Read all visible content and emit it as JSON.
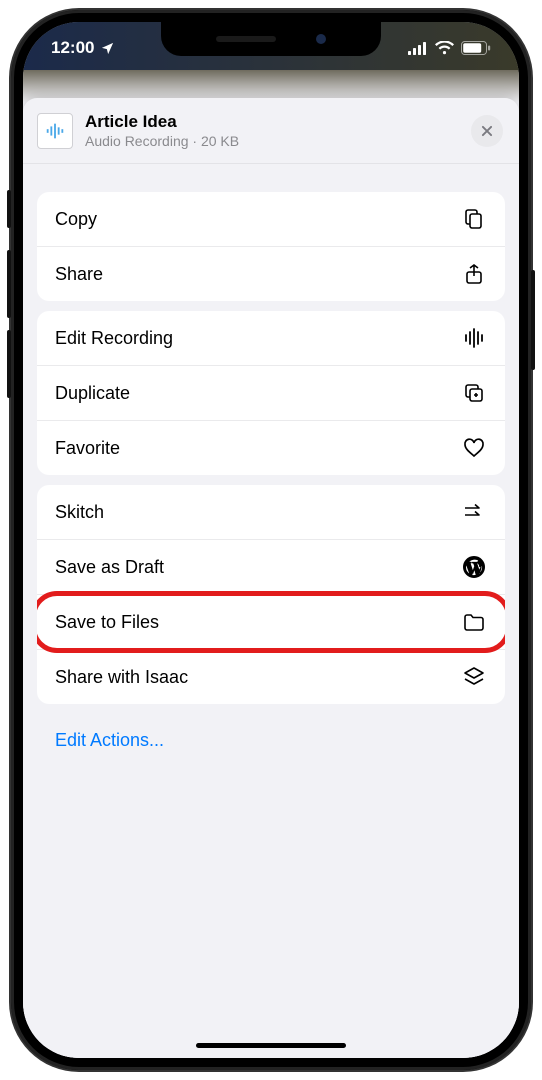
{
  "status": {
    "time": "12:00"
  },
  "header": {
    "title": "Article Idea",
    "subtitle": "Audio Recording · 20 KB"
  },
  "groups": [
    {
      "rows": [
        {
          "label": "Copy",
          "icon": "copy"
        },
        {
          "label": "Share",
          "icon": "share"
        }
      ]
    },
    {
      "rows": [
        {
          "label": "Edit Recording",
          "icon": "waveform"
        },
        {
          "label": "Duplicate",
          "icon": "duplicate"
        },
        {
          "label": "Favorite",
          "icon": "heart"
        }
      ]
    },
    {
      "rows": [
        {
          "label": "Skitch",
          "icon": "skitch"
        },
        {
          "label": "Save as Draft",
          "icon": "wordpress"
        },
        {
          "label": "Save to Files",
          "icon": "folder",
          "highlight": true
        },
        {
          "label": "Share with Isaac",
          "icon": "stack"
        }
      ]
    }
  ],
  "footer": {
    "edit_label": "Edit Actions..."
  }
}
